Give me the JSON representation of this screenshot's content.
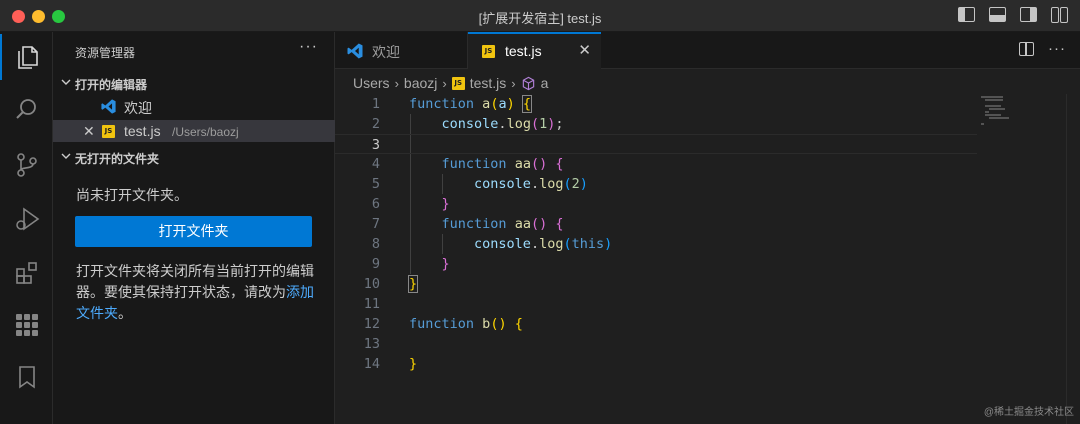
{
  "window": {
    "title": "[扩展开发宿主] test.js"
  },
  "colors": {
    "accent": "#0078d4",
    "link": "#4daafc",
    "js_badge": "#f1c40f"
  },
  "activity_bar": [
    "files-icon",
    "search-icon",
    "source-control-icon",
    "run-debug-icon",
    "extensions-icon",
    "grid-icon",
    "bookmark-icon"
  ],
  "sidebar": {
    "title": "资源管理器",
    "more": "···",
    "open_editors": {
      "label": "打开的编辑器",
      "items": [
        {
          "label": "欢迎",
          "path": ""
        },
        {
          "close": "✕",
          "badge": "JS",
          "label": "test.js",
          "path": "/Users/baozj"
        }
      ]
    },
    "no_folder": {
      "label": "无打开的文件夹",
      "message": "尚未打开文件夹。",
      "button": "打开文件夹",
      "description": "打开文件夹将关闭所有当前打开的编辑器。要使其保持打开状态，请改为",
      "link": "添加文件夹",
      "tail": "。"
    }
  },
  "tabs": [
    {
      "label": "欢迎",
      "active": false
    },
    {
      "label": "test.js",
      "badge": "JS",
      "active": true,
      "close": "✕"
    }
  ],
  "tab_actions": {
    "more": "···"
  },
  "breadcrumbs": {
    "parts": [
      "Users",
      "baozj",
      "test.js",
      "a"
    ],
    "badge": "JS"
  },
  "code": {
    "current_line": 3,
    "line_numbers": [
      "1",
      "2",
      "3",
      "4",
      "5",
      "6",
      "7",
      "8",
      "9",
      "10",
      "11",
      "12",
      "13",
      "14"
    ]
  },
  "watermark": "@稀土掘金技术社区"
}
